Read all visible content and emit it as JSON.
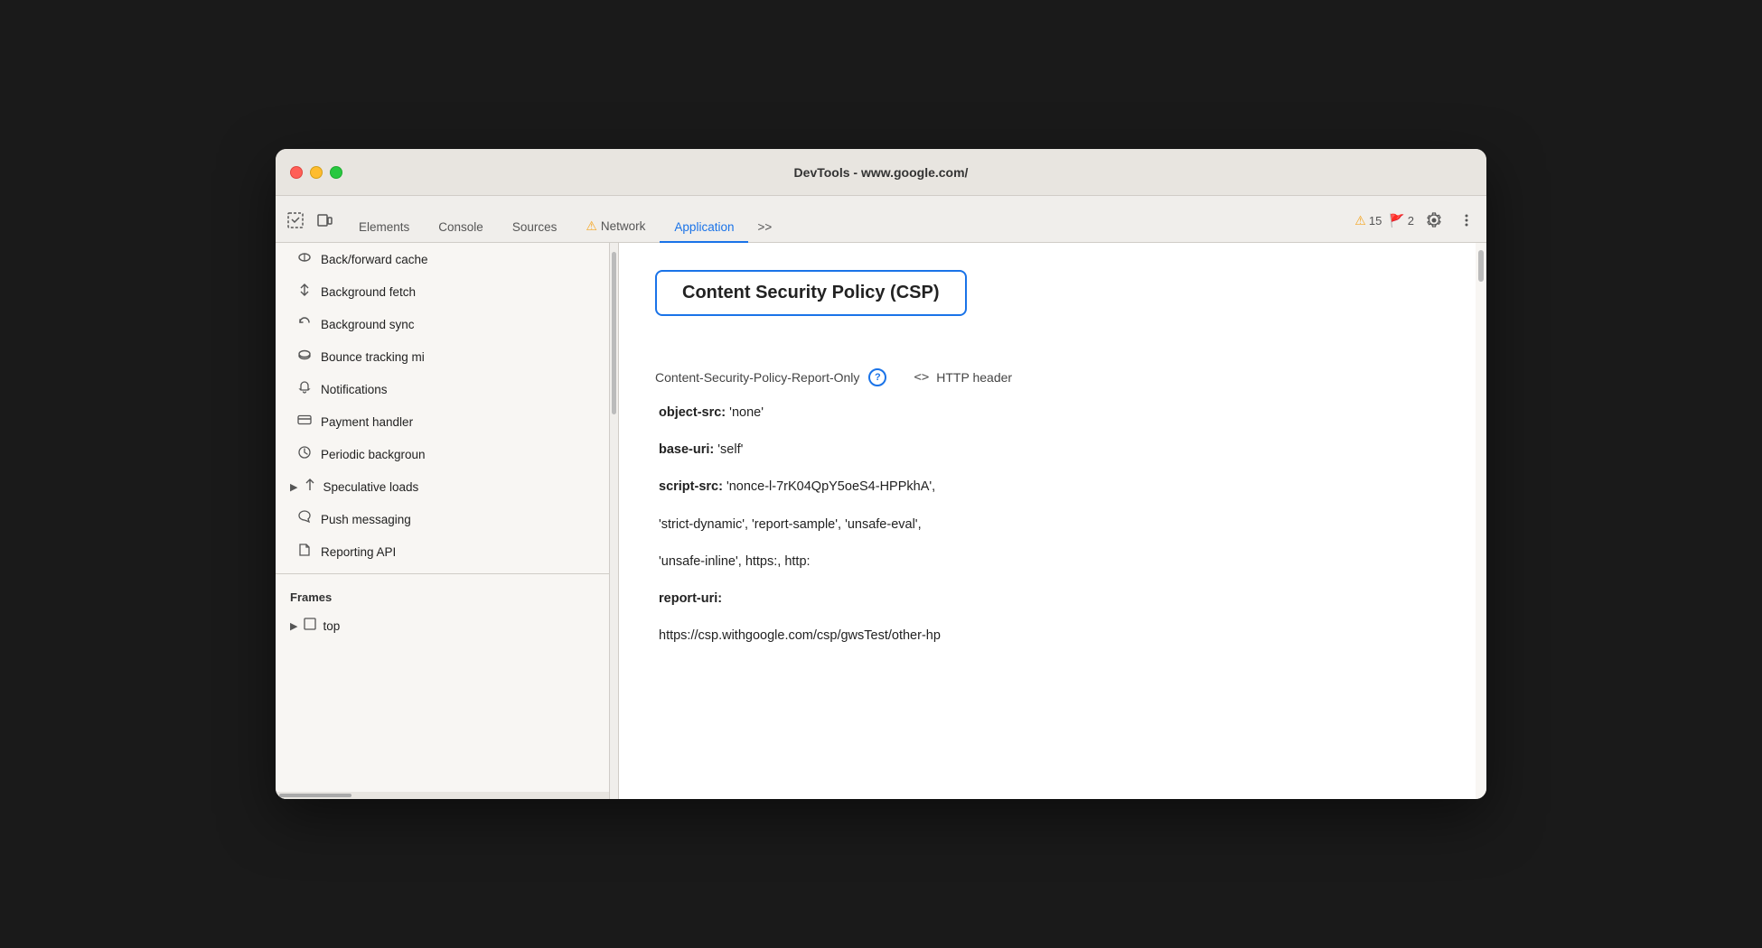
{
  "window": {
    "title": "DevTools - www.google.com/"
  },
  "traffic_lights": {
    "red": "close",
    "yellow": "minimize",
    "green": "maximize"
  },
  "tabs": [
    {
      "id": "elements",
      "label": "Elements",
      "active": false,
      "has_warning": false
    },
    {
      "id": "console",
      "label": "Console",
      "active": false,
      "has_warning": false
    },
    {
      "id": "sources",
      "label": "Sources",
      "active": false,
      "has_warning": false
    },
    {
      "id": "network",
      "label": "Network",
      "active": false,
      "has_warning": true,
      "warning_count": ""
    },
    {
      "id": "application",
      "label": "Application",
      "active": true,
      "has_warning": false
    }
  ],
  "tab_more": ">>",
  "badges": {
    "warning": {
      "icon": "⚠",
      "count": "15"
    },
    "error": {
      "icon": "🚩",
      "count": "2"
    }
  },
  "sidebar": {
    "items": [
      {
        "id": "back-forward",
        "icon": "⊙",
        "label": "Back/forward cache",
        "type": "db"
      },
      {
        "id": "background-fetch",
        "icon": "↕",
        "label": "Background fetch",
        "type": "sync"
      },
      {
        "id": "background-sync",
        "icon": "↻",
        "label": "Background sync",
        "type": "sync"
      },
      {
        "id": "bounce-tracking",
        "icon": "⊙",
        "label": "Bounce tracking mi",
        "type": "db"
      },
      {
        "id": "notifications",
        "icon": "🔔",
        "label": "Notifications",
        "type": "bell"
      },
      {
        "id": "payment-handler",
        "icon": "💳",
        "label": "Payment handler",
        "type": "card"
      },
      {
        "id": "periodic-background",
        "icon": "⏱",
        "label": "Periodic backgroun",
        "type": "clock"
      },
      {
        "id": "speculative-loads",
        "icon": "↕",
        "label": "Speculative loads",
        "type": "expand"
      },
      {
        "id": "push-messaging",
        "icon": "☁",
        "label": "Push messaging",
        "type": "cloud"
      },
      {
        "id": "reporting-api",
        "icon": "📄",
        "label": "Reporting API",
        "type": "file"
      }
    ],
    "frames_section": "Frames",
    "frames_item": "top"
  },
  "main": {
    "csp_title": "Content Security Policy (CSP)",
    "policy_label": "Content-Security-Policy-Report-Only",
    "http_header_label": "HTTP header",
    "directives": [
      {
        "id": "object-src",
        "key": "object-src:",
        "value": " 'none'"
      },
      {
        "id": "base-uri",
        "key": "base-uri:",
        "value": " 'self'"
      },
      {
        "id": "script-src",
        "key": "script-src:",
        "value": " 'nonce-l-7rK04QpY5oeS4-HPPkhA',"
      },
      {
        "id": "strict-dynamic",
        "key": "",
        "value": "'strict-dynamic', 'report-sample', 'unsafe-eval',"
      },
      {
        "id": "unsafe-inline",
        "key": "",
        "value": "'unsafe-inline', https:, http:"
      },
      {
        "id": "report-uri",
        "key": "report-uri:",
        "value": ""
      },
      {
        "id": "report-uri-value",
        "key": "",
        "value": "https://csp.withgoogle.com/csp/gwsTest/other-hp"
      }
    ]
  }
}
